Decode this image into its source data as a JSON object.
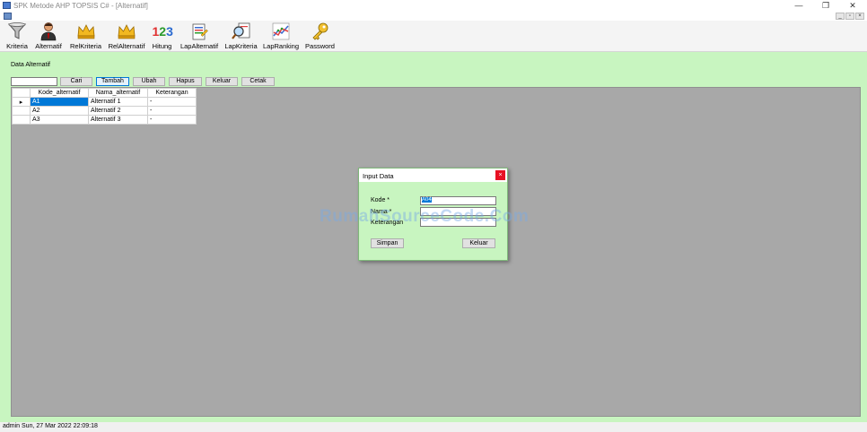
{
  "window": {
    "title": "SPK Metode AHP TOPSIS C# - [Alternatif]",
    "minimize": "—",
    "restore": "❐",
    "close": "✕"
  },
  "mdi": {
    "minimize": "_",
    "restore": "▫",
    "close": "×"
  },
  "toolbar": {
    "items": [
      {
        "label": "Kriteria",
        "icon": "funnel-icon"
      },
      {
        "label": "Alternatif",
        "icon": "person-icon"
      },
      {
        "label": "RelKriteria",
        "icon": "crown-icon"
      },
      {
        "label": "RelAlternatif",
        "icon": "crown-icon"
      },
      {
        "label": "Hitung",
        "icon": "numbers-123-icon",
        "icon_text": "123"
      },
      {
        "label": "LapAlternatif",
        "icon": "report-icon"
      },
      {
        "label": "LapKriteria",
        "icon": "magnifier-report-icon"
      },
      {
        "label": "LapRanking",
        "icon": "chart-icon"
      },
      {
        "label": "Password",
        "icon": "key-icon"
      }
    ]
  },
  "main": {
    "section_label": "Data Alternatif",
    "search_value": "",
    "buttons": {
      "cari": "Cari",
      "tambah": "Tambah",
      "ubah": "Ubah",
      "hapus": "Hapus",
      "keluar": "Keluar",
      "cetak": "Cetak"
    },
    "grid": {
      "columns": [
        "Kode_alternatif",
        "Nama_alternatif",
        "Keterangan"
      ],
      "current_row_marker": "▸",
      "rows": [
        [
          "A1",
          "Alternatif 1",
          "-"
        ],
        [
          "A2",
          "Alternatif 2",
          "-"
        ],
        [
          "A3",
          "Alternatif 3",
          "-"
        ]
      ]
    }
  },
  "dialog": {
    "title": "Input Data",
    "close": "×",
    "labels": {
      "kode": "Kode *",
      "nama": "Nama *",
      "keterangan": "Keterangan"
    },
    "values": {
      "kode": "A04",
      "nama": "",
      "keterangan": ""
    },
    "buttons": {
      "simpan": "Simpan",
      "keluar": "Keluar"
    }
  },
  "watermark": "RumahSourceCode.Com",
  "statusbar": {
    "text": "admin Sun, 27 Mar 2022 22:09:18"
  },
  "colors": {
    "main_background": "#c8f5c0",
    "grid_area": "#a8a8a8",
    "selection": "#0078d7",
    "close_red": "#e81123"
  }
}
